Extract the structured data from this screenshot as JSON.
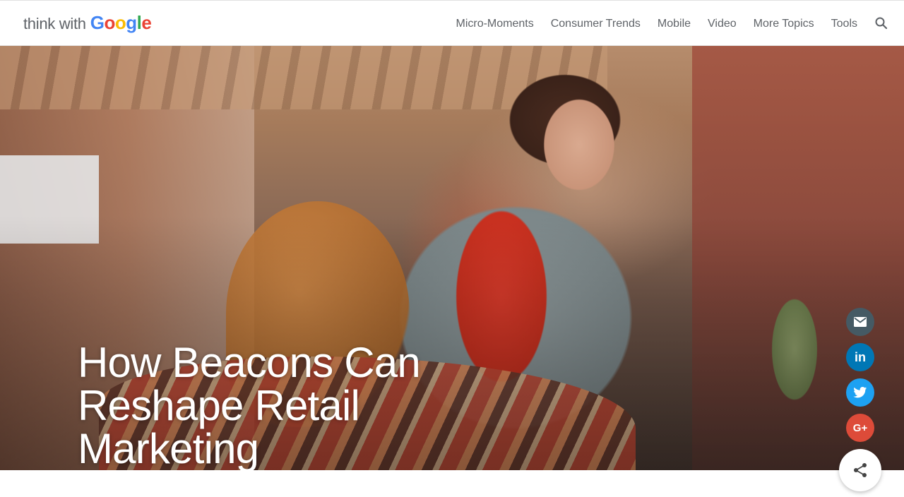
{
  "header": {
    "logo": {
      "prefix": "think with",
      "brand": [
        "G",
        "o",
        "o",
        "g",
        "l",
        "e"
      ]
    },
    "nav": [
      {
        "label": "Micro-Moments"
      },
      {
        "label": "Consumer Trends"
      },
      {
        "label": "Mobile"
      },
      {
        "label": "Video"
      },
      {
        "label": "More Topics"
      },
      {
        "label": "Tools"
      }
    ],
    "search_icon": "search-icon"
  },
  "hero": {
    "title_lines": [
      "How Beacons Can",
      "Reshape Retail",
      "Marketing"
    ]
  },
  "share": {
    "buttons": [
      {
        "icon": "email-icon",
        "color": "#455a64"
      },
      {
        "icon": "linkedin-icon",
        "label": "in",
        "color": "#0077b5"
      },
      {
        "icon": "twitter-icon",
        "color": "#1da1f2"
      },
      {
        "icon": "google-plus-icon",
        "label": "G+",
        "color": "#dd4b39"
      }
    ],
    "main_icon": "share-icon"
  }
}
